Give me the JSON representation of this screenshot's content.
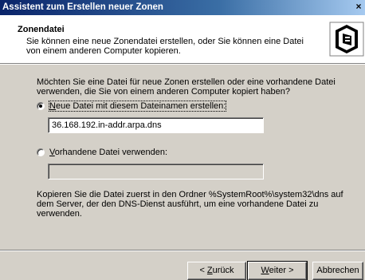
{
  "window": {
    "title": "Assistent zum Erstellen neuer Zonen",
    "close_glyph": "×"
  },
  "header": {
    "title": "Zonendatei",
    "subtitle": "Sie können eine neue Zonendatei erstellen, oder Sie können eine Datei von einem anderen Computer kopieren.",
    "icon": "server-zone-icon"
  },
  "main": {
    "question": "Möchten Sie eine Datei für neue Zonen erstellen oder eine vorhandene Datei verwenden, die Sie von einem anderen Computer kopiert haben?",
    "option_new": {
      "accel": "N",
      "label_rest": "eue Datei mit diesem Dateinamen erstellen:",
      "checked": true,
      "value": "36.168.192.in-addr.arpa.dns"
    },
    "option_existing": {
      "accel": "V",
      "label_rest": "orhandene Datei verwenden:",
      "checked": false,
      "value": ""
    },
    "note": "Kopieren Sie die Datei zuerst in den Ordner %SystemRoot%\\system32\\dns auf dem Server, der den DNS-Dienst ausführt, um eine vorhandene Datei zu verwenden."
  },
  "buttons": {
    "back_prefix": "< ",
    "back_accel": "Z",
    "back_rest": "urück",
    "next_accel": "W",
    "next_rest": "eiter >",
    "cancel": "Abbrechen"
  }
}
